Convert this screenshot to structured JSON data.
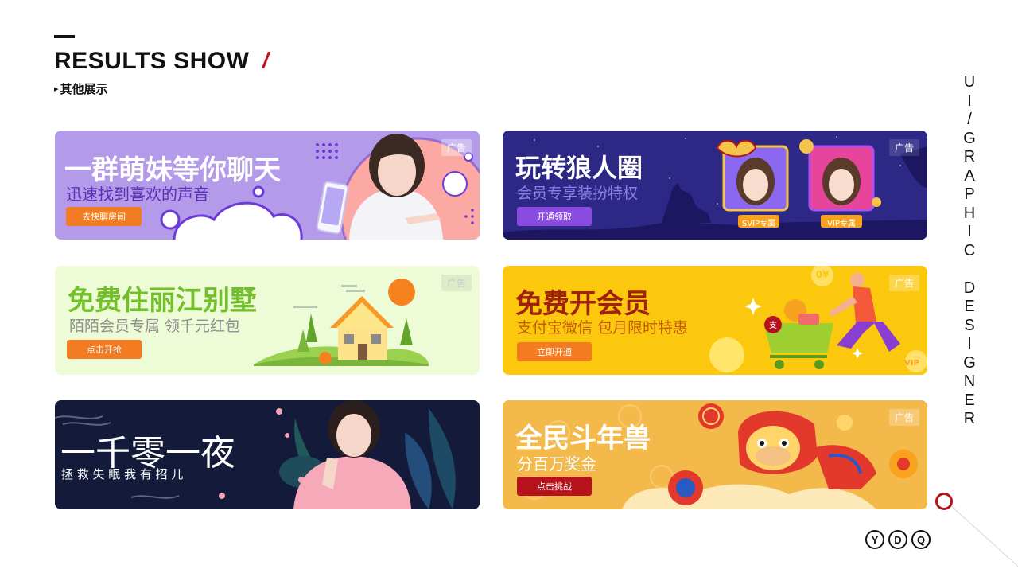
{
  "header": {
    "title": "RESULTS SHOW",
    "slash": "/",
    "subtitle_marker": "▸",
    "subtitle": "其他展示"
  },
  "side": {
    "vertical_text": "UI/GRAPHIC DESIGNER",
    "monogram": [
      "Y",
      "D",
      "Q"
    ]
  },
  "colors": {
    "accent_red": "#b5121b"
  },
  "banners": [
    {
      "headline": "一群萌妹等你聊天",
      "subline": "迅速找到喜欢的声音",
      "button": "去快聊房间",
      "ad_tag": "广告",
      "theme": {
        "background": "#b79ae8",
        "button": "#f37b21"
      }
    },
    {
      "headline": "玩转狼人圈",
      "subline": "会员专享装扮特权",
      "button": "开通领取",
      "ad_tag": "广告",
      "badges": [
        "SVIP专属",
        "VIP专属"
      ],
      "theme": {
        "background": "#2b2683",
        "button": "#8a4ce0"
      }
    },
    {
      "headline": "免费住丽江别墅",
      "subline": "陌陌会员专属 领千元红包",
      "button": "点击开抢",
      "ad_tag": "广告",
      "theme": {
        "background": "#ecfbd4",
        "button": "#f37b21"
      }
    },
    {
      "headline": "免费开会员",
      "subline": "支付宝微信 包月限时特惠",
      "button": "立即开通",
      "ad_tag": "广告",
      "badge_price": "0¥",
      "badge_vip": "VIP",
      "cart_char": "支",
      "theme": {
        "background": "#fbc80e",
        "button": "#f37b21"
      }
    },
    {
      "headline": "一千零一夜",
      "subline": "拯 救 失 眠 我 有 招 儿",
      "theme": {
        "background": "#121838"
      }
    },
    {
      "headline": "全民斗年兽",
      "subline": "分百万奖金",
      "button": "点击挑战",
      "ad_tag": "广告",
      "theme": {
        "background": "#f3b94c",
        "button": "#b5121b"
      }
    }
  ]
}
